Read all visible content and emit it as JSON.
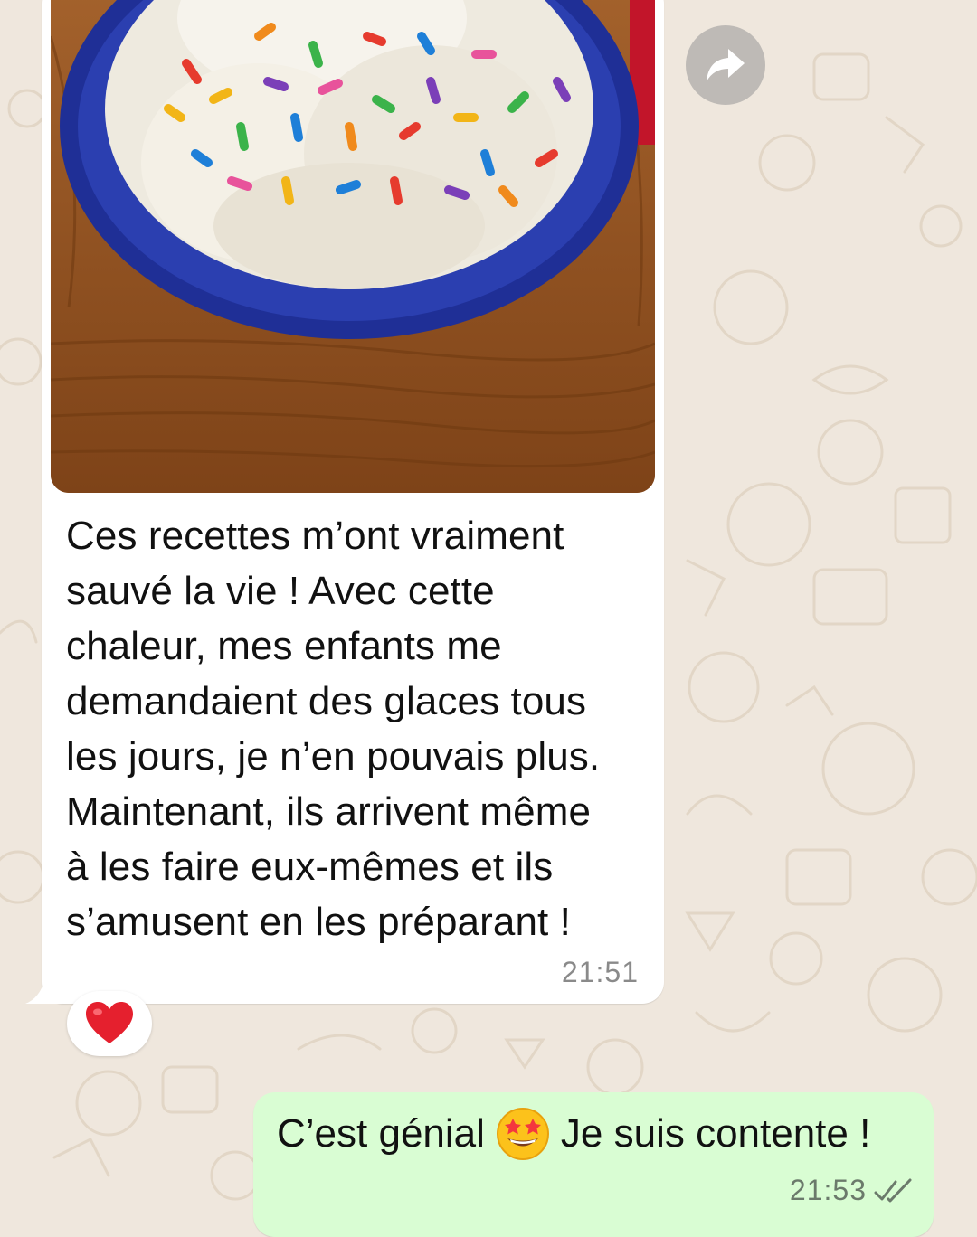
{
  "conversation": {
    "incoming": {
      "image": {
        "subject": "ice-cream-bowl-with-sprinkles"
      },
      "text": "Ces recettes m’ont vraiment\nsauvé la vie ! Avec cette\nchaleur, mes enfants me\ndemandaient des glaces tous\nles jours, je n’en pouvais plus.\nMaintenant, ils arrivent même\nà les faire eux-mêmes et ils\ns’amusent en les préparant !",
      "time": "21:51",
      "reaction": "heart-emoji"
    },
    "outgoing": {
      "text_part1": "C’est génial",
      "emoji": "star-struck-emoji",
      "text_part2": "Je suis contente !",
      "time": "21:53",
      "status_icon": "double-check-icon"
    },
    "forward_icon": "forward-arrow-icon"
  },
  "colors": {
    "wallpaper": "#efe7dd",
    "incoming_bubble": "#ffffff",
    "outgoing_bubble": "#d9fdd3",
    "timestamp": "#8a8a8a",
    "heart": "#e5202e"
  }
}
